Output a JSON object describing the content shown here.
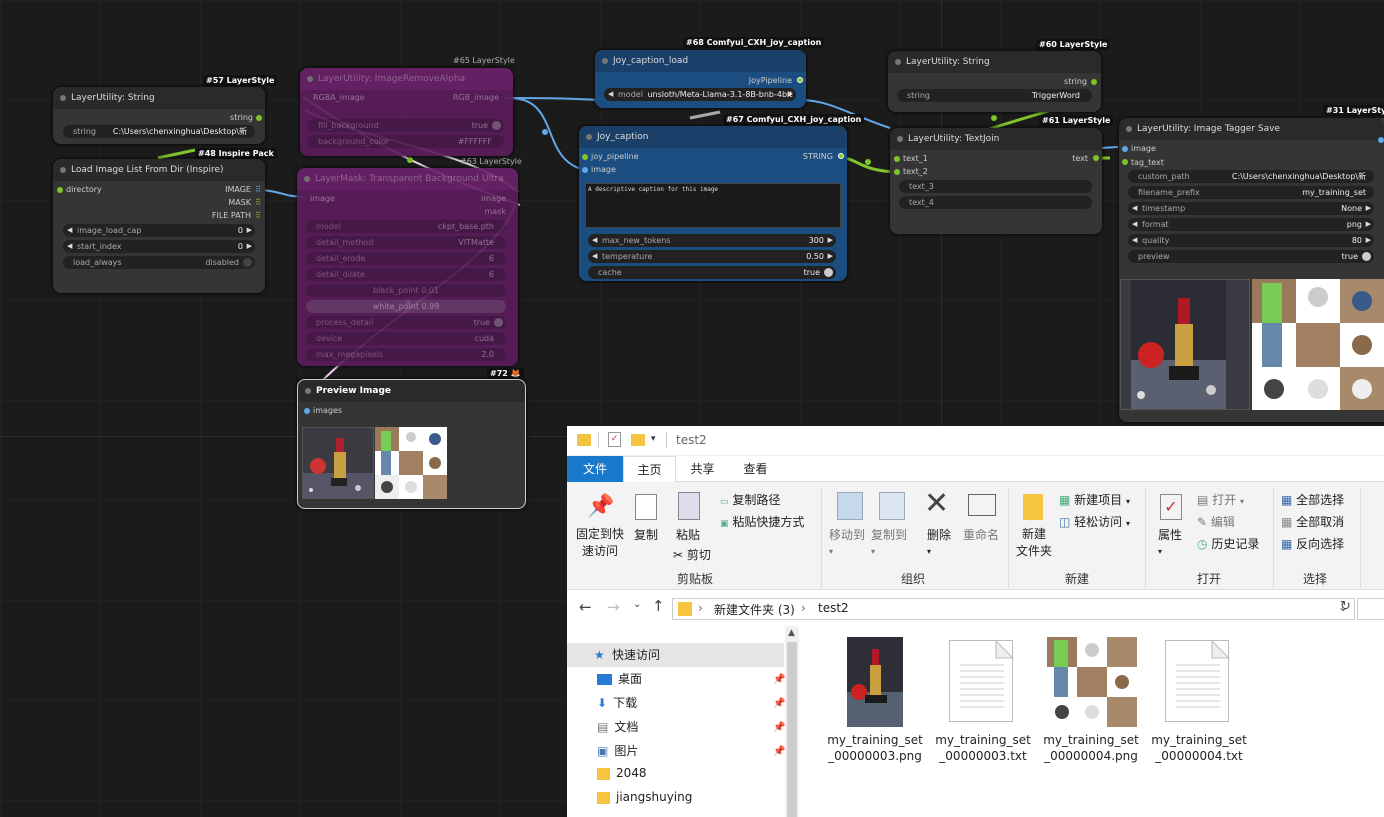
{
  "canvas": {
    "nodes": {
      "string57": {
        "badge": "#57 LayerStyle",
        "title": "LayerUtility: String",
        "output": "string",
        "widget_label": "string",
        "widget_value": "C:\\Users\\chenxinghua\\Desktop\\新"
      },
      "load48": {
        "badge": "#48 Inspire Pack",
        "title": "Load Image List From Dir (Inspire)",
        "input": "directory",
        "outputs": [
          "IMAGE",
          "MASK",
          "FILE PATH"
        ],
        "widgets": [
          {
            "label": "image_load_cap",
            "value": "0"
          },
          {
            "label": "start_index",
            "value": "0"
          },
          {
            "label": "load_always",
            "value": "disabled"
          }
        ]
      },
      "remove65": {
        "badge": "#65 LayerStyle",
        "title": "LayerUtility: ImageRemoveAlpha",
        "input": "RGBA_image",
        "output": "RGB_image",
        "widgets": [
          {
            "label": "fill_background",
            "value": "true"
          },
          {
            "label": "background_color",
            "value": "#FFFFFF"
          }
        ]
      },
      "mask63": {
        "badge": "#63 LayerStyle",
        "title": "LayerMask: Transparent Background Ultra",
        "input": "image",
        "outputs": [
          "image",
          "mask"
        ],
        "widgets": [
          {
            "label": "model",
            "value": "ckpt_base.pth"
          },
          {
            "label": "detail_method",
            "value": "VITMatte"
          },
          {
            "label": "detail_erode",
            "value": "6"
          },
          {
            "label": "detail_dilate",
            "value": "6"
          },
          {
            "label": "black_point",
            "value": "0.01"
          },
          {
            "label": "white_point",
            "value": "0.99"
          },
          {
            "label": "process_detail",
            "value": "true"
          },
          {
            "label": "device",
            "value": "cuda"
          },
          {
            "label": "max_megapixels",
            "value": "2.0"
          }
        ]
      },
      "preview72": {
        "badge": "#72",
        "title": "Preview Image",
        "input": "images"
      },
      "joyload68": {
        "badge": "#68 Comfyui_CXH_joy_caption",
        "title": "Joy_caption_load",
        "output": "JoyPipeline",
        "widget_label": "model",
        "widget_value": "unsloth/Meta-Llama-3.1-8B-bnb-4bit"
      },
      "joy67": {
        "badge": "#67 Comfyui_CXH_joy_caption",
        "title": "Joy_caption",
        "inputs": [
          "joy_pipeline",
          "image"
        ],
        "output": "STRING",
        "prompt": "A descriptive caption for this image",
        "widgets": [
          {
            "label": "max_new_tokens",
            "value": "300"
          },
          {
            "label": "temperature",
            "value": "0.50"
          },
          {
            "label": "cache",
            "value": "true"
          }
        ]
      },
      "string60": {
        "badge": "#60 LayerStyle",
        "title": "LayerUtility: String",
        "output": "string",
        "widget_label": "string",
        "widget_value": "TriggerWord"
      },
      "join61": {
        "badge": "#61 LayerStyle",
        "title": "LayerUtility: TextJoin",
        "inputs": [
          "text_1",
          "text_2"
        ],
        "output": "text",
        "widgets": [
          "text_3",
          "text_4"
        ]
      },
      "save31": {
        "badge": "#31 LayerStyl",
        "title": "LayerUtility: Image Tagger Save",
        "inputs": [
          "image",
          "tag_text"
        ],
        "widgets": [
          {
            "label": "custom_path",
            "value": "C:\\Users\\chenxinghua\\Desktop\\新"
          },
          {
            "label": "filename_prefix",
            "value": "my_training_set"
          },
          {
            "label": "timestamp",
            "value": "None"
          },
          {
            "label": "format",
            "value": "png"
          },
          {
            "label": "quality",
            "value": "80"
          },
          {
            "label": "preview",
            "value": "true"
          }
        ]
      }
    }
  },
  "explorer": {
    "title": "test2",
    "tabs": [
      "文件",
      "主页",
      "共享",
      "查看"
    ],
    "ribbon": {
      "clipboard": {
        "pin": "固定到快\n速访问",
        "copy": "复制",
        "paste": "粘贴",
        "copy_path": "复制路径",
        "paste_shortcut": "粘贴快捷方式",
        "cut": "剪切",
        "group": "剪贴板"
      },
      "organize": {
        "move_to": "移动到",
        "copy_to": "复制到",
        "delete": "删除",
        "rename": "重命名",
        "group": "组织"
      },
      "new": {
        "new_folder": "新建\n文件夹",
        "new_item": "新建项目",
        "easy_access": "轻松访问",
        "group": "新建"
      },
      "open": {
        "properties": "属性",
        "open": "打开",
        "edit": "编辑",
        "history": "历史记录",
        "group": "打开"
      },
      "select": {
        "select_all": "全部选择",
        "select_none": "全部取消",
        "invert": "反向选择",
        "group": "选择"
      }
    },
    "address": [
      "新建文件夹 (3)",
      "test2"
    ],
    "nav": {
      "quick_access": "快速访问",
      "items": [
        "桌面",
        "下载",
        "文档",
        "图片",
        "2048",
        "jiangshuying"
      ]
    },
    "files": [
      {
        "name": "my_training_set\n_00000003.png",
        "kind": "image-lipstick"
      },
      {
        "name": "my_training_set\n_00000003.txt",
        "kind": "text"
      },
      {
        "name": "my_training_set\n_00000004.png",
        "kind": "image-collage"
      },
      {
        "name": "my_training_set\n_00000004.txt",
        "kind": "text"
      }
    ]
  }
}
